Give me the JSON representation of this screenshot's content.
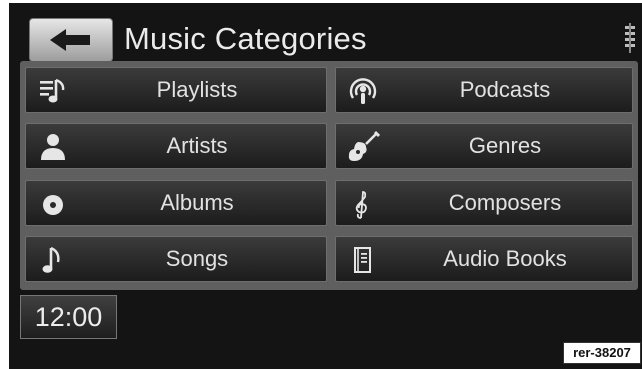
{
  "header": {
    "title": "Music Categories",
    "back_icon": "arrow-left-icon",
    "right_icon": "equalizer-icon"
  },
  "categories": [
    {
      "label": "Playlists",
      "icon": "playlist-icon"
    },
    {
      "label": "Podcasts",
      "icon": "podcast-icon"
    },
    {
      "label": "Artists",
      "icon": "person-icon"
    },
    {
      "label": "Genres",
      "icon": "guitar-icon"
    },
    {
      "label": "Albums",
      "icon": "disc-icon"
    },
    {
      "label": "Composers",
      "icon": "treble-clef-icon"
    },
    {
      "label": "Songs",
      "icon": "music-note-icon"
    },
    {
      "label": "Audio Books",
      "icon": "book-icon"
    }
  ],
  "footer": {
    "clock": "12:00"
  },
  "reference_tag": "rer-38207",
  "colors": {
    "screen_bg": "#141414",
    "tile_border": "#6e6e6e",
    "text": "#e2e2e2"
  }
}
